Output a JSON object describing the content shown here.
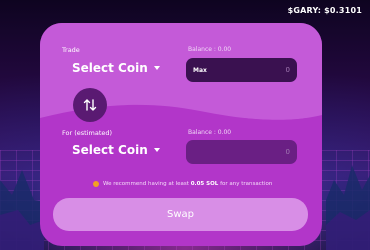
{
  "header": {
    "price_text": "$GARY: $0.3101"
  },
  "from": {
    "label": "Trade",
    "balance": "Balance : 0.00",
    "select_label": "Select Coin",
    "max_label": "Max",
    "amount": "0"
  },
  "to": {
    "label": "For (estimated)",
    "balance": "Balance : 0.00",
    "select_label": "Select Coin",
    "amount": "0"
  },
  "notice": {
    "prefix": "We recommend having at least",
    "amount": "0.05 SOL",
    "suffix": "for any transaction"
  },
  "swap_button": {
    "label": "Swap"
  },
  "icons": {
    "switch": "swap-arrows-icon",
    "caret": "chevron-down-icon",
    "warning": "warning-icon"
  },
  "colors": {
    "card_top": "#c45ad8",
    "card_bottom": "#b236c9",
    "input_dark": "#3a1150",
    "swap_button": "#d88ee6",
    "warning": "#f2a024"
  }
}
